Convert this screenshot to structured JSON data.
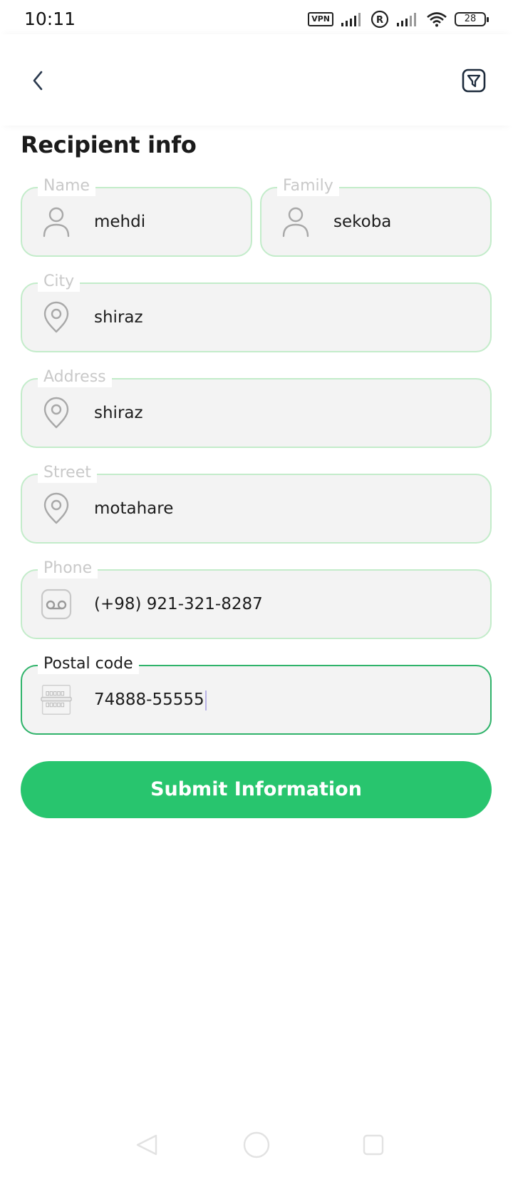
{
  "status_bar": {
    "time": "10:11",
    "vpn_label": "VPN",
    "battery_level": "28",
    "icons": [
      "vpn-icon",
      "signal-icon",
      "registered-icon",
      "signal-icon",
      "wifi-icon",
      "battery-icon"
    ]
  },
  "app_bar": {
    "back_icon": "chevron-left-icon",
    "action_icon": "filter-icon"
  },
  "page_title": "Recipient info",
  "form": {
    "name": {
      "label": "Name",
      "value": "mehdi",
      "icon": "user-icon"
    },
    "family": {
      "label": "Family",
      "value": "sekoba",
      "icon": "user-icon"
    },
    "city": {
      "label": "City",
      "value": "shiraz",
      "icon": "location-pin-icon"
    },
    "address": {
      "label": "Address",
      "value": "shiraz",
      "icon": "location-pin-icon"
    },
    "street": {
      "label": "Street",
      "value": "motahare",
      "icon": "location-pin-icon"
    },
    "phone": {
      "label": "Phone",
      "value": "(+98) 921-321-8287",
      "icon": "voicemail-icon"
    },
    "postal_code": {
      "label": "Postal code",
      "value": "74888-55555",
      "icon": "mailbox-icon",
      "focused": true
    }
  },
  "submit_label": "Submit Information",
  "colors": {
    "accent": "#28c56e",
    "field_border": "#c3ecca",
    "field_border_active": "#2fb36a",
    "field_bg": "#f3f3f3"
  },
  "nav_bar": {
    "icons": [
      "back-triangle-icon",
      "home-circle-icon",
      "recents-square-icon"
    ]
  }
}
